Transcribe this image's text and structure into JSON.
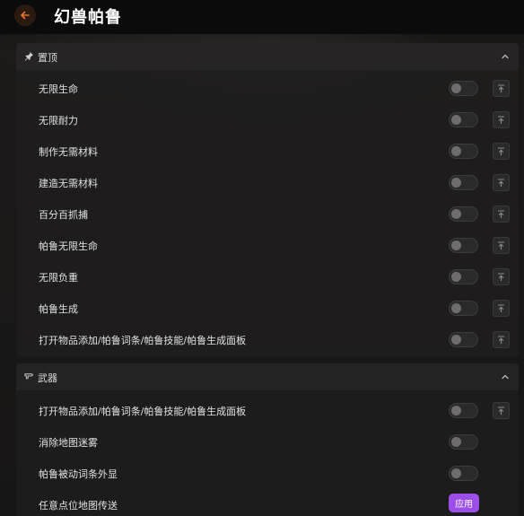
{
  "header": {
    "title": "幻兽帕鲁",
    "back_icon": "arrow-left-icon",
    "back_accent": "#e8742a"
  },
  "sections": [
    {
      "title": "置顶",
      "icon": "pin-icon",
      "items": [
        {
          "label": "无限生命",
          "control": "toggle",
          "on": false,
          "pin": true
        },
        {
          "label": "无限耐力",
          "control": "toggle",
          "on": false,
          "pin": true
        },
        {
          "label": "制作无需材料",
          "control": "toggle",
          "on": false,
          "pin": true
        },
        {
          "label": "建造无需材料",
          "control": "toggle",
          "on": false,
          "pin": true
        },
        {
          "label": "百分百抓捕",
          "control": "toggle",
          "on": false,
          "pin": true
        },
        {
          "label": "帕鲁无限生命",
          "control": "toggle",
          "on": false,
          "pin": true
        },
        {
          "label": "无限负重",
          "control": "toggle",
          "on": false,
          "pin": true
        },
        {
          "label": "帕鲁生成",
          "control": "toggle",
          "on": false,
          "pin": true
        },
        {
          "label": "打开物品添加/帕鲁词条/帕鲁技能/帕鲁生成面板",
          "control": "toggle",
          "on": false,
          "pin": true
        }
      ]
    },
    {
      "title": "武器",
      "icon": "weapon-icon",
      "items": [
        {
          "label": "打开物品添加/帕鲁词条/帕鲁技能/帕鲁生成面板",
          "control": "toggle",
          "on": false,
          "pin": true
        },
        {
          "label": "消除地图迷雾",
          "control": "toggle",
          "on": false,
          "pin": false
        },
        {
          "label": "帕鲁被动词条外显",
          "control": "toggle",
          "on": false,
          "pin": false
        },
        {
          "label": "任意点位地图传送",
          "control": "button",
          "button_label": "应用",
          "pin": false
        }
      ]
    }
  ],
  "colors": {
    "apply_button": "#9b4ee8"
  }
}
